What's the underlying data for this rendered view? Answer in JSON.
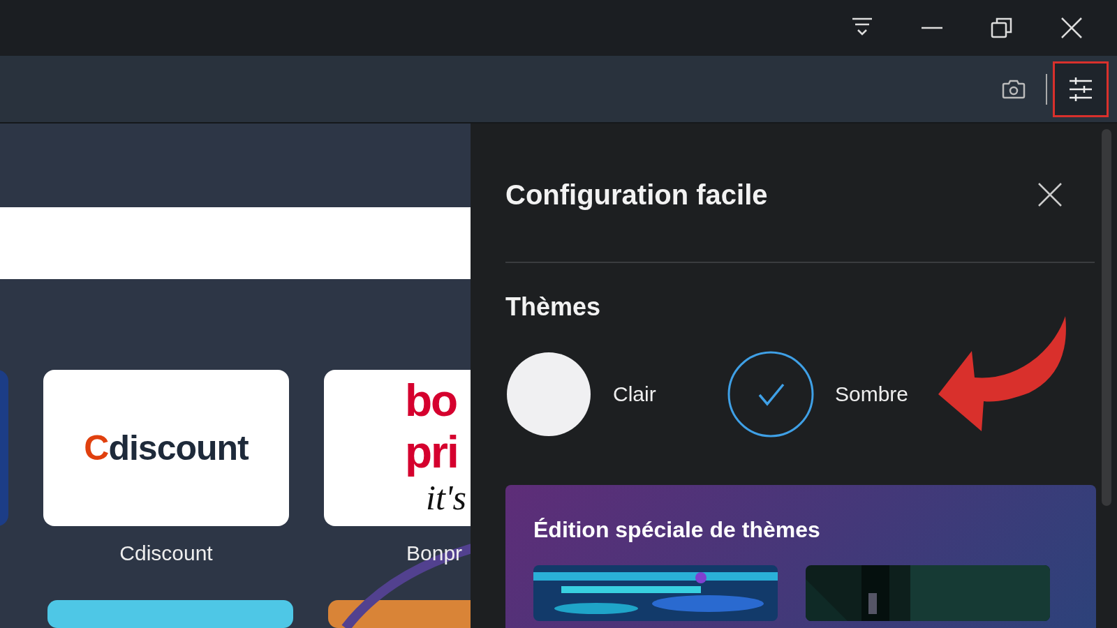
{
  "title_bar": {
    "buttons": [
      {
        "kind": "menu"
      },
      {
        "kind": "minimize"
      },
      {
        "kind": "restore"
      },
      {
        "kind": "close"
      }
    ]
  },
  "toolbar": {
    "settings_highlighted": true
  },
  "page": {
    "tiles": [
      {
        "kind": "partial"
      },
      {
        "kind": "cdiscount",
        "logo_first": "C",
        "logo_rest": "discount",
        "label": "Cdiscount"
      },
      {
        "kind": "bonprix",
        "logo_lines": [
          "bo",
          "pri",
          "it's"
        ],
        "label": "Bonpr"
      }
    ]
  },
  "panel": {
    "title": "Configuration facile",
    "section": "Thèmes",
    "themes": [
      {
        "label": "Clair",
        "selected": false,
        "kind": "light"
      },
      {
        "label": "Sombre",
        "selected": true,
        "kind": "dark"
      }
    ],
    "special": {
      "title": "Édition spéciale de thèmes"
    }
  }
}
